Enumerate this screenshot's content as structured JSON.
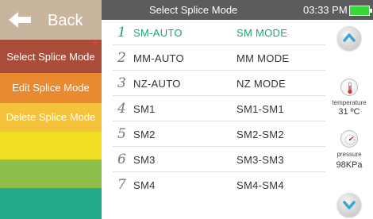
{
  "sidebar": {
    "back_label": "Back",
    "items": [
      {
        "label": "Select Splice Mode",
        "color": "#a84d3a"
      },
      {
        "label": "Edit Splice Mode",
        "color": "#e98a30"
      },
      {
        "label": "Delete Splice Mode",
        "color": "#f5c33a"
      },
      {
        "label": "",
        "color": "#f1dd22"
      },
      {
        "label": "",
        "color": "#8dbd4a"
      },
      {
        "label": "",
        "color": "#22aa8a"
      }
    ]
  },
  "header": {
    "title": "Select Splice Mode",
    "time": "03:33 PM",
    "battery_color": "#37d93a"
  },
  "modes": [
    {
      "num": "1",
      "name": "SM-AUTO",
      "mode": "SM MODE",
      "selected": true
    },
    {
      "num": "2",
      "name": "MM-AUTO",
      "mode": "MM MODE",
      "selected": false
    },
    {
      "num": "3",
      "name": "NZ-AUTO",
      "mode": "NZ MODE",
      "selected": false
    },
    {
      "num": "4",
      "name": "SM1",
      "mode": "SM1-SM1",
      "selected": false
    },
    {
      "num": "5",
      "name": "SM2",
      "mode": "SM2-SM2",
      "selected": false
    },
    {
      "num": "6",
      "name": "SM3",
      "mode": "SM3-SM3",
      "selected": false
    },
    {
      "num": "7",
      "name": "SM4",
      "mode": "SM4-SM4",
      "selected": false
    }
  ],
  "sensors": {
    "temperature_label": "temperature",
    "temperature_value": "31 ºC",
    "pressure_label": "pressure",
    "pressure_value": "98KPa"
  },
  "colors": {
    "selected_text": "#17a86c",
    "scroll_arrow": "#3aa6d8"
  },
  "icons": {
    "back": "back-arrow-icon",
    "scroll_up": "chevron-up-icon",
    "scroll_down": "chevron-down-icon",
    "temperature": "thermometer-icon",
    "pressure": "pressure-gauge-icon"
  }
}
